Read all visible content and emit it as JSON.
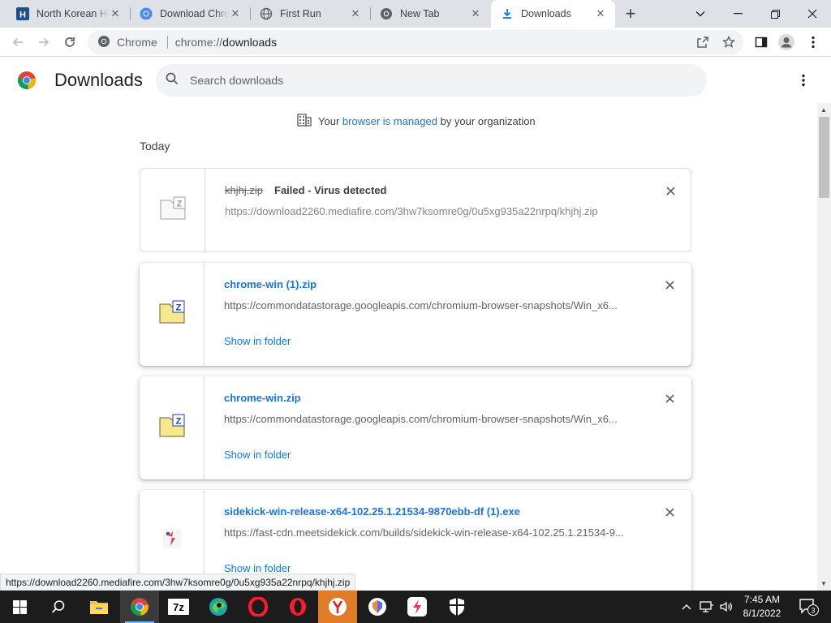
{
  "tabs": [
    {
      "title": "North Korean Hackers",
      "favicon": "letter-h-favicon"
    },
    {
      "title": "Download Chromium",
      "favicon": "chromium-favicon"
    },
    {
      "title": "First Run",
      "favicon": "globe-favicon"
    },
    {
      "title": "New Tab",
      "favicon": "chrome-favicon"
    },
    {
      "title": "Downloads",
      "favicon": "download-favicon"
    }
  ],
  "toolbar": {
    "site_chip": "Chrome",
    "url_scheme": "chrome://",
    "url_path": "downloads"
  },
  "page": {
    "title": "Downloads",
    "search_placeholder": "Search downloads",
    "managed_prefix": "Your",
    "managed_link": "browser is managed",
    "managed_suffix": "by your organization",
    "date_header": "Today",
    "show_in_folder": "Show in folder"
  },
  "downloads": [
    {
      "name": "khjhj.zip",
      "status": "Failed - Virus detected",
      "url": "https://download2260.mediafire.com/3hw7ksomre0g/0u5xg935a22nrpq/khjhj.zip"
    },
    {
      "name": "chrome-win (1).zip",
      "url": "https://commondatastorage.googleapis.com/chromium-browser-snapshots/Win_x6..."
    },
    {
      "name": "chrome-win.zip",
      "url": "https://commondatastorage.googleapis.com/chromium-browser-snapshots/Win_x6..."
    },
    {
      "name": "sidekick-win-release-x64-102.25.1.21534-9870ebb-df (1).exe",
      "url": "https://fast-cdn.meetsidekick.com/builds/sidekick-win-release-x64-102.25.1.21534-9..."
    }
  ],
  "status_url": "https://download2260.mediafire.com/3hw7ksomre0g/0u5xg935a22nrpq/khjhj.zip",
  "taskbar": {
    "apps": [
      "windows-start",
      "search",
      "file-explorer",
      "chrome",
      "7-zip",
      "edge",
      "opera",
      "opera-gx",
      "yandex",
      "brave",
      "sidekick",
      "shield"
    ],
    "time": "7:45 AM",
    "date": "8/1/2022",
    "notification_count": "3"
  },
  "colors": {
    "link_blue": "#1a73e8",
    "tabstrip_bg": "#dee1e6",
    "taskbar_bg": "#1c1c1c"
  }
}
